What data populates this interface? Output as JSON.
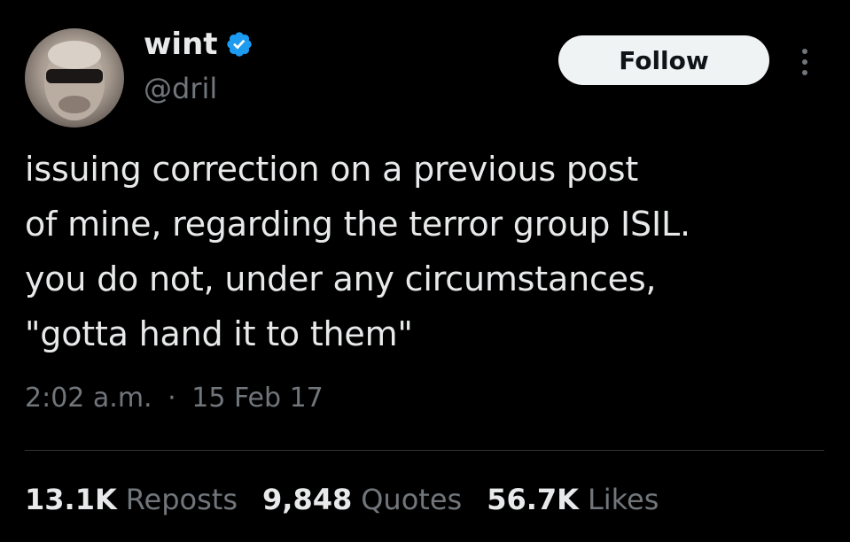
{
  "author": {
    "display_name": "wint",
    "handle": "@dril",
    "verified": true
  },
  "follow_button": {
    "label": "Follow"
  },
  "tweet": {
    "lines": [
      "issuing correction on a previous post",
      "of mine, regarding the terror group ISIL.",
      "you do not, under any circumstances,",
      "\"gotta hand it to them\""
    ],
    "time": "2:02 a.m.",
    "separator": "·",
    "date": "15 Feb 17"
  },
  "stats": {
    "reposts": {
      "count": "13.1K",
      "label": "Reposts"
    },
    "quotes": {
      "count": "9,848",
      "label": "Quotes"
    },
    "likes": {
      "count": "56.7K",
      "label": "Likes"
    }
  },
  "icons": {
    "verified": "verified-badge-icon",
    "more": "more-options-icon"
  },
  "colors": {
    "background": "#000000",
    "primary_text": "#e7e9ea",
    "secondary_text": "#71767b",
    "verified_blue": "#1d9bf0",
    "follow_bg": "#eff3f4"
  }
}
